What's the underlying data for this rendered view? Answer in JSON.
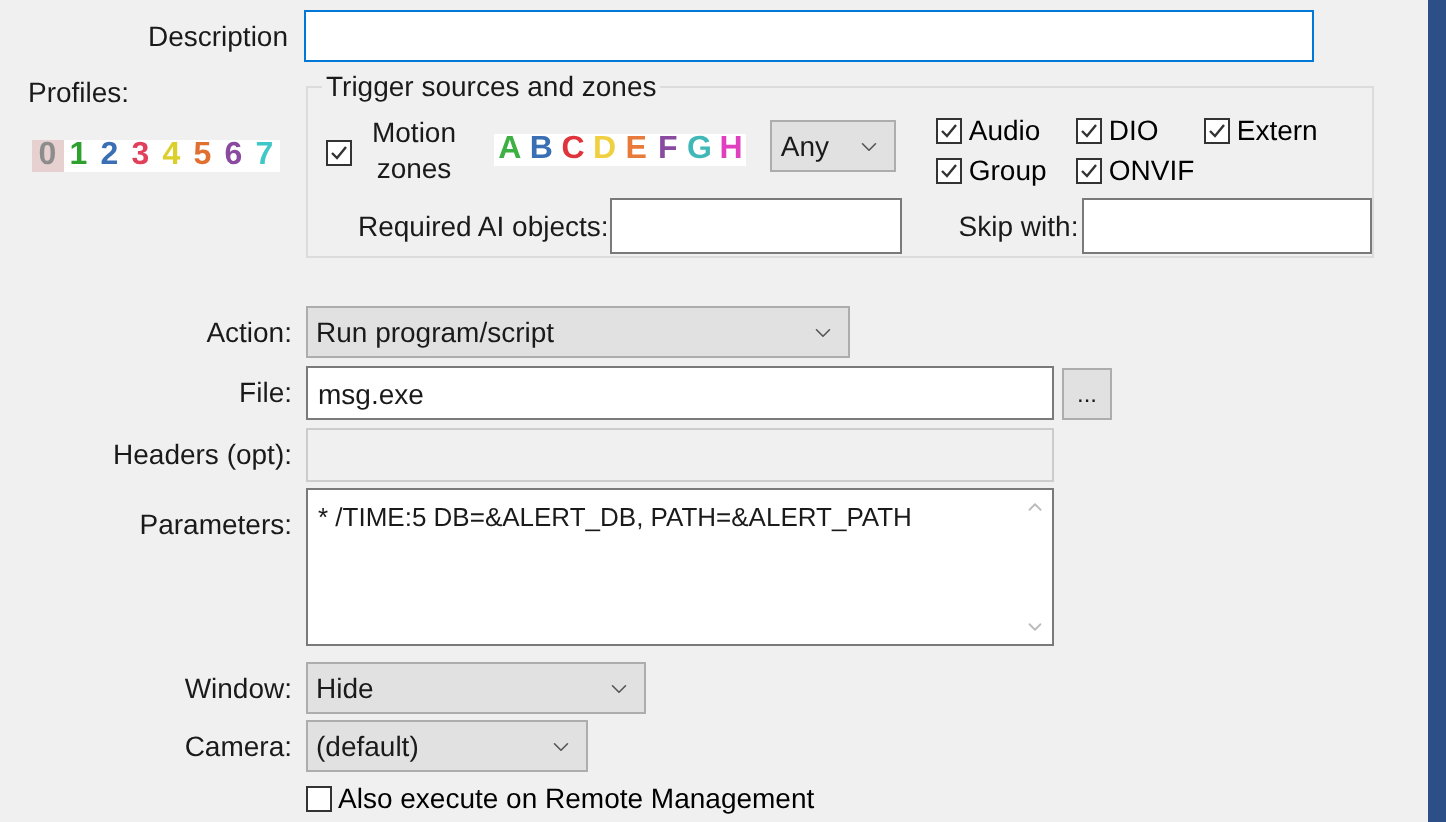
{
  "description": {
    "label": "Description"
  },
  "profiles": {
    "label": "Profiles:",
    "items": [
      {
        "label": "0",
        "color": "#8c8c8c",
        "selected": true
      },
      {
        "label": "1",
        "color": "#2ea02e",
        "selected": false
      },
      {
        "label": "2",
        "color": "#3a6fb5",
        "selected": false
      },
      {
        "label": "3",
        "color": "#e0405a",
        "selected": false
      },
      {
        "label": "4",
        "color": "#dccf2a",
        "selected": false
      },
      {
        "label": "5",
        "color": "#e07030",
        "selected": false
      },
      {
        "label": "6",
        "color": "#8a4aa0",
        "selected": false
      },
      {
        "label": "7",
        "color": "#40c8c8",
        "selected": false
      }
    ]
  },
  "trigger": {
    "title": "Trigger sources and zones",
    "motion": {
      "label": "Motion zones",
      "checked": true
    },
    "zones": [
      {
        "label": "A",
        "color": "#3cb043"
      },
      {
        "label": "B",
        "color": "#3a6fb5"
      },
      {
        "label": "C",
        "color": "#e0343c"
      },
      {
        "label": "D",
        "color": "#f0d040"
      },
      {
        "label": "E",
        "color": "#e87a3a"
      },
      {
        "label": "F",
        "color": "#8a4aa0"
      },
      {
        "label": "G",
        "color": "#40b8b8"
      },
      {
        "label": "H",
        "color": "#e040c0"
      }
    ],
    "zone_mode": "Any",
    "sources": [
      {
        "label": "Audio",
        "checked": true
      },
      {
        "label": "DIO",
        "checked": true
      },
      {
        "label": "Extern",
        "checked": true
      },
      {
        "label": "Group",
        "checked": true
      },
      {
        "label": "ONVIF",
        "checked": true
      }
    ],
    "ai_label": "Required AI objects:",
    "skip_label": "Skip with:"
  },
  "action": {
    "label": "Action:",
    "value": "Run program/script"
  },
  "file": {
    "label": "File:",
    "value": "msg.exe",
    "browse": "..."
  },
  "headers": {
    "label": "Headers (opt):",
    "disabled": true
  },
  "parameters": {
    "label": "Parameters:",
    "value": "* /TIME:5 DB=&ALERT_DB, PATH=&ALERT_PATH"
  },
  "window": {
    "label": "Window:",
    "value": "Hide"
  },
  "camera": {
    "label": "Camera:",
    "value": "(default)"
  },
  "remote": {
    "label": "Also execute on Remote Management",
    "checked": false
  }
}
